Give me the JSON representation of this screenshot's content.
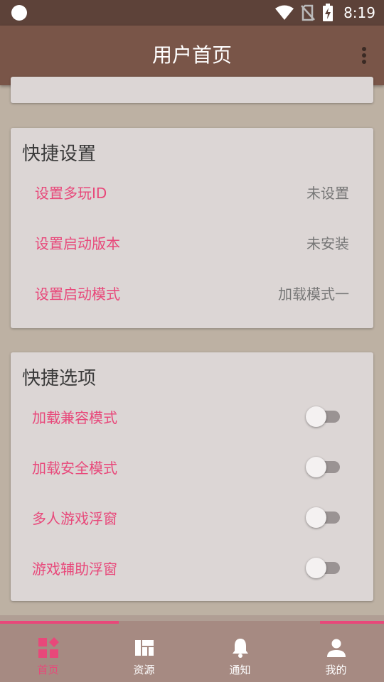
{
  "status_bar": {
    "time": "8:19"
  },
  "app_bar": {
    "title": "用户首页"
  },
  "quick_settings": {
    "title": "快捷设置",
    "rows": [
      {
        "label": "设置多玩ID",
        "value": "未设置"
      },
      {
        "label": "设置启动版本",
        "value": "未安装"
      },
      {
        "label": "设置启动模式",
        "value": "加载模式一"
      }
    ]
  },
  "quick_options": {
    "title": "快捷选项",
    "rows": [
      {
        "label": "加载兼容模式",
        "on": false
      },
      {
        "label": "加载安全模式",
        "on": false
      },
      {
        "label": "多人游戏浮窗",
        "on": false
      },
      {
        "label": "游戏辅助浮窗",
        "on": false
      }
    ]
  },
  "bottom_nav": {
    "items": [
      {
        "label": "首页",
        "icon": "home-grid-icon",
        "active": true
      },
      {
        "label": "资源",
        "icon": "dashboard-icon",
        "active": false
      },
      {
        "label": "通知",
        "icon": "bell-icon",
        "active": false
      },
      {
        "label": "我的",
        "icon": "person-icon",
        "active": false
      }
    ]
  },
  "colors": {
    "accent": "#e8487a",
    "app_bar": "#795548",
    "status_bar": "#5d4239",
    "background": "#bdb1a3"
  }
}
